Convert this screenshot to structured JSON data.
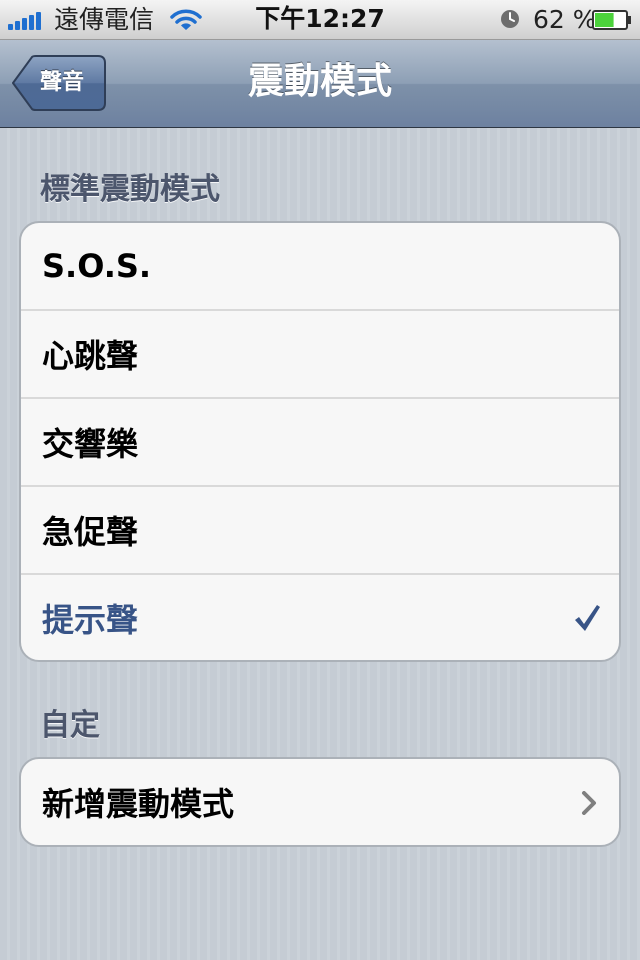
{
  "status_bar": {
    "carrier": "遠傳電信",
    "time": "下午12:27",
    "battery_percent": "62 %",
    "icons": [
      "signal-icon",
      "wifi-icon",
      "alarm-icon",
      "battery-icon"
    ]
  },
  "nav": {
    "back_label": "聲音",
    "title": "震動模式"
  },
  "standard_section": {
    "header": "標準震動模式",
    "items": [
      {
        "label": "S.O.S."
      },
      {
        "label": "心跳聲"
      },
      {
        "label": "交響樂"
      },
      {
        "label": "急促聲"
      },
      {
        "label": "提示聲",
        "selected": true
      }
    ]
  },
  "custom_section": {
    "header": "自定",
    "items": [
      {
        "label": "新增震動模式"
      }
    ]
  },
  "colors": {
    "selected_text": "#385487",
    "section_header": "#4c566c",
    "battery_fill": "#4cd23c",
    "signal": "#1f6fd0"
  },
  "battery_level": 0.62
}
